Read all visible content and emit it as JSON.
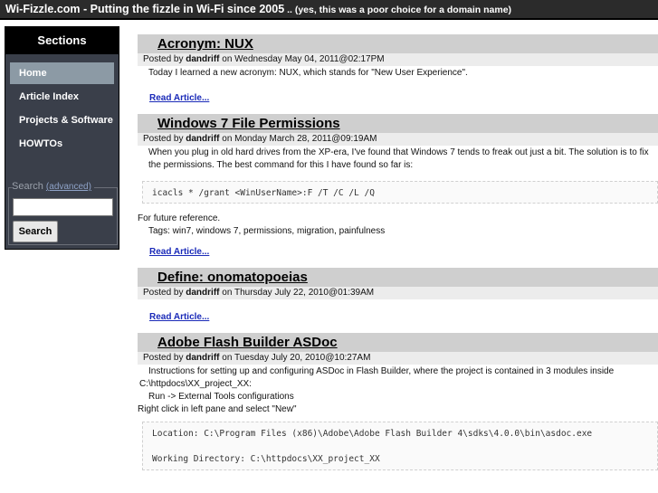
{
  "header": {
    "title": "Wi-Fizzle.com - Putting the fizzle in Wi-Fi since 2005",
    "tagline": " .. (yes, this was a poor choice for a domain name)"
  },
  "sidebar": {
    "heading": "Sections",
    "items": [
      {
        "label": "Home"
      },
      {
        "label": "Article Index"
      },
      {
        "label": "Projects & Software"
      },
      {
        "label": "HOWTOs"
      }
    ],
    "search": {
      "legend": "Search",
      "advanced": "(advanced)",
      "value": "",
      "button": "Search"
    }
  },
  "articles": [
    {
      "title": "Acronym: NUX",
      "posted_prefix": "Posted by ",
      "author": "dandriff",
      "date": " on Wednesday May 04, 2011@02:17PM",
      "text": "Today I learned a new acronym: NUX, which stands for \"New User Experience\".",
      "read": "Read Article..."
    },
    {
      "title": "Windows 7 File Permissions",
      "posted_prefix": "Posted by ",
      "author": "dandriff",
      "date": " on Monday March 28, 2011@09:19AM",
      "text": "When you plug in old hard drives from the XP-era, I've found that Windows 7 tends to freak out just a bit. The solution is to fix the permissions. The best command for this I have found so far is:",
      "code": "icacls * /grant <WinUserName>:F /T /C /L /Q",
      "after": "For future reference.",
      "tags": "Tags: win7, windows 7, permissions, migration, painfulness",
      "read": "Read Article..."
    },
    {
      "title": "Define: onomatopoeias",
      "posted_prefix": "Posted by ",
      "author": "dandriff",
      "date": " on Thursday July 22, 2010@01:39AM",
      "read": "Read Article..."
    },
    {
      "title": "Adobe Flash Builder ASDoc",
      "posted_prefix": "Posted by ",
      "author": "dandriff",
      "date": " on Tuesday July 20, 2010@10:27AM",
      "text1": "Instructions for setting up and configuring ASDoc in Flash Builder, where the project is contained in 3 modules inside",
      "text2": "C:\\httpdocs\\XX_project_XX:",
      "text3": "Run -> External Tools configurations",
      "text4": "Right click in left pane and select \"New\"",
      "code1": "Location: C:\\Program Files (x86)\\Adobe\\Adobe Flash Builder 4\\sdks\\4.0.0\\bin\\asdoc.exe",
      "code2": "Working Directory: C:\\httpdocs\\XX_project_XX"
    }
  ]
}
